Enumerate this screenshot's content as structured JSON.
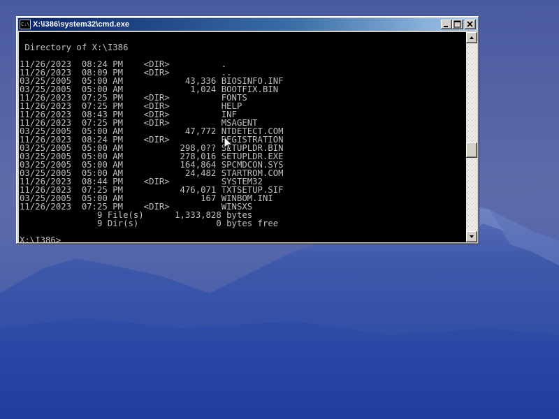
{
  "window": {
    "title": "X:\\i386\\system32\\cmd.exe",
    "icon_label": "C:\\"
  },
  "console": {
    "lines": [
      "",
      " Directory of X:\\I386",
      "",
      "11/26/2023  08:24 PM    <DIR>          .",
      "11/26/2023  08:09 PM    <DIR>          ..",
      "03/25/2005  05:00 AM            43,336 BIOSINFO.INF",
      "03/25/2005  05:00 AM             1,024 BOOTFIX.BIN",
      "11/26/2023  07:25 PM    <DIR>          FONTS",
      "11/26/2023  07:25 PM    <DIR>          HELP",
      "11/26/2023  08:43 PM    <DIR>          INF",
      "11/26/2023  07:25 PM    <DIR>          MSAGENT",
      "03/25/2005  05:00 AM            47,772 NTDETECT.COM",
      "11/26/2023  08:24 PM    <DIR>          REGISTRATION",
      "03/25/2005  05:00 AM           298,0?? SETUPLDR.BIN",
      "03/25/2005  05:00 AM           278,016 SETUPLDR.EXE",
      "03/25/2005  05:00 AM           164,864 SPCMDCON.SYS",
      "03/25/2005  05:00 AM            24,482 STARTROM.COM",
      "11/26/2023  08:44 PM    <DIR>          SYSTEM32",
      "11/26/2023  07:25 PM           476,071 TXTSETUP.SIF",
      "03/25/2005  05:00 AM               167 WINBOM.INI",
      "11/26/2023  07:25 PM    <DIR>          WINSXS",
      "               9 File(s)      1,333,828 bytes",
      "               9 Dir(s)               0 bytes free",
      "",
      "X:\\I386>"
    ]
  },
  "colors": {
    "console_bg": "#000000",
    "console_fg": "#c0c0c0",
    "titlebar_start": "#0a246a",
    "titlebar_end": "#a6caf0"
  },
  "icons": {
    "window_icon": "cmd-icon",
    "minimize": "minimize-icon",
    "maximize": "maximize-icon",
    "close": "close-icon",
    "mouse": "mouse-pointer-icon"
  }
}
